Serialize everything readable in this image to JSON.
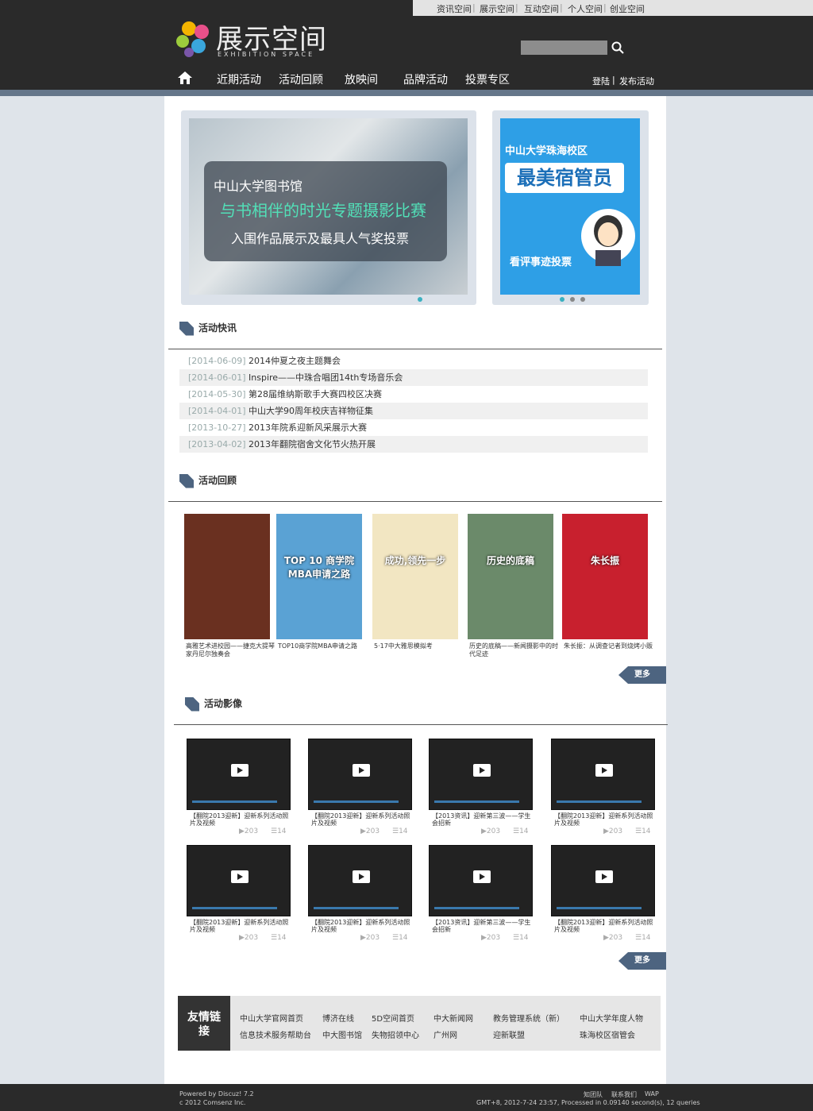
{
  "topnav": [
    "资讯空间",
    "展示空间",
    "互动空间",
    "个人空间",
    "创业空间"
  ],
  "logo": {
    "cn": "展示空间",
    "en": "EXHIBITION SPACE"
  },
  "mainnav": [
    "近期活动",
    "活动回顾",
    "放映间",
    "品牌活动",
    "投票专区"
  ],
  "login": "登陆",
  "post": "发布活动",
  "banner_left": {
    "t1": "中山大学图书馆",
    "t2": "与书相伴的时光专题摄影比赛",
    "t3": "入围作品展示及最具人气奖投票"
  },
  "banner_right": {
    "t1": "中山大学珠海校区",
    "t2": "最美宿管员",
    "t3": "看评事迹投票"
  },
  "sec_news": "活动快讯",
  "news": [
    {
      "date": "[2014-06-09]",
      "title": "2014仲夏之夜主题舞会"
    },
    {
      "date": "[2014-06-01]",
      "title": "Inspire——中珠合唱团14th专场音乐会"
    },
    {
      "date": "[2014-05-30]",
      "title": "第28届维纳斯歌手大赛四校区决赛"
    },
    {
      "date": "[2014-04-01]",
      "title": "中山大学90周年校庆吉祥物征集"
    },
    {
      "date": "[2013-10-27]",
      "title": "2013年院系迎新风采展示大赛"
    },
    {
      "date": "[2013-04-02]",
      "title": "2013年翻院宿舍文化节火热开展"
    }
  ],
  "sec_review": "活动回顾",
  "reviews": [
    {
      "cap": "高雅艺术进校园——捷克大提琴家丹尼尔独奏会",
      "color": "#6a3020"
    },
    {
      "cap": "TOP10商学院MBA申请之路",
      "color": "#5aa2d4",
      "txt": "TOP 10 商学院MBA申请之路"
    },
    {
      "cap": "5·17中大雅思模拟考",
      "color": "#f2e6c2",
      "txt": "成功,领先一步"
    },
    {
      "cap": "历史的底稿——新闻摄影中的时代足迹",
      "color": "#6b8a6a",
      "txt": "历史的底稿"
    },
    {
      "cap": "朱长振：从调查记者到烧烤小贩",
      "color": "#c8202e",
      "txt": "朱长振"
    }
  ],
  "more": "更多",
  "sec_video": "活动影像",
  "videos": [
    {
      "cap": "【翻院2013迎新】迎新系列活动照片及视频",
      "v": "203",
      "c": "14"
    },
    {
      "cap": "【翻院2013迎新】迎新系列活动照片及视频",
      "v": "203",
      "c": "14"
    },
    {
      "cap": "【2013资讯】迎新第三波——学生会招新",
      "v": "203",
      "c": "14"
    },
    {
      "cap": "【翻院2013迎新】迎新系列活动照片及视频",
      "v": "203",
      "c": "14"
    },
    {
      "cap": "【翻院2013迎新】迎新系列活动照片及视频",
      "v": "203",
      "c": "14"
    },
    {
      "cap": "【翻院2013迎新】迎新系列活动照片及视频",
      "v": "203",
      "c": "14"
    },
    {
      "cap": "【2013资讯】迎新第三波——学生会招新",
      "v": "203",
      "c": "14"
    },
    {
      "cap": "【翻院2013迎新】迎新系列活动照片及视频",
      "v": "203",
      "c": "14"
    }
  ],
  "links_label": "友情链接",
  "links_row1": [
    "中山大学官网首页",
    "博济在线",
    "5D空间首页",
    "中大新闻网",
    "教务管理系统（新）",
    "中山大学年度人物"
  ],
  "links_row2": [
    "信息技术服务帮助台",
    "中大图书馆",
    "失物招领中心",
    "广州网",
    "迎新联盟",
    "珠海校区宿管会"
  ],
  "footer": {
    "powered": "Powered by Discuz! 7.2",
    "copy": "c  2012 Comsenz Inc.",
    "links": [
      "知团队",
      "联系我们",
      "WAP"
    ],
    "stats": "GMT+8,  2012-7-24 23:57,   Processed in 0.09140 second(s), 12 queries"
  }
}
